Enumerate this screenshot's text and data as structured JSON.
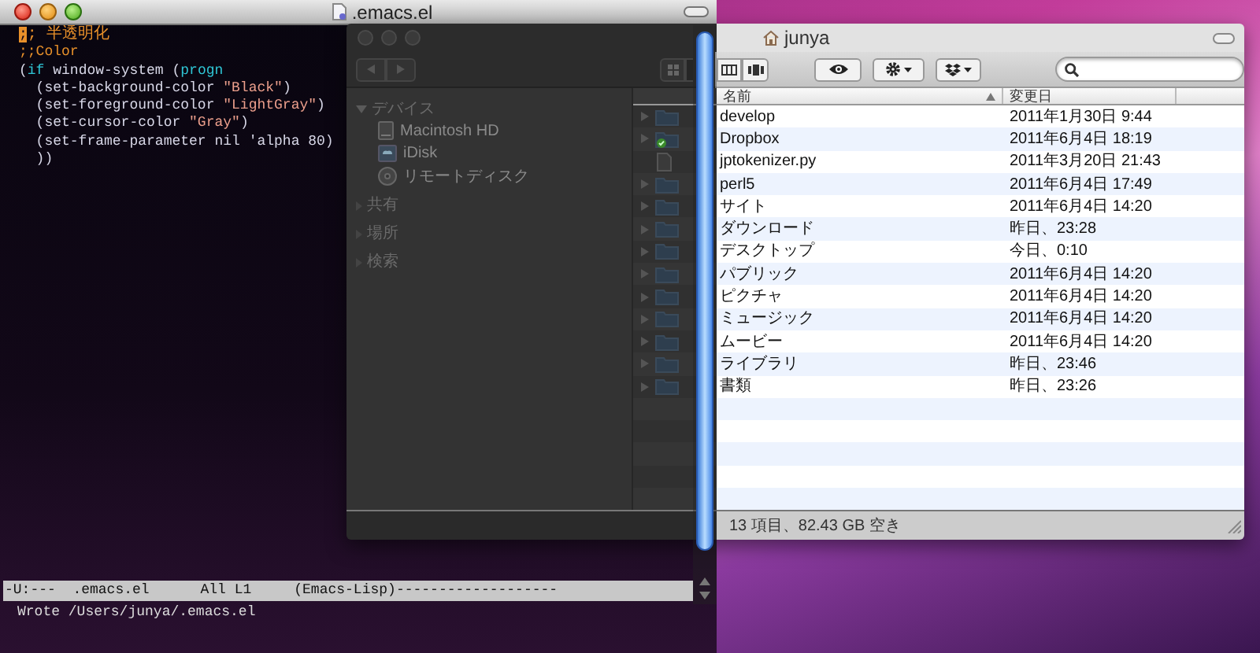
{
  "emacs": {
    "title": ".emacs.el",
    "lines": [
      [
        {
          "kind": "cursor",
          "text": ";"
        },
        {
          "kind": "comment",
          "text": "; 半透明化"
        }
      ],
      [
        {
          "kind": "comment",
          "text": ";;Color"
        }
      ],
      [
        {
          "kind": "text",
          "text": "("
        },
        {
          "kind": "keyword",
          "text": "if"
        },
        {
          "kind": "text",
          "text": " window-system ("
        },
        {
          "kind": "keyword",
          "text": "progn"
        }
      ],
      [
        {
          "kind": "text",
          "text": "  (set-background-color "
        },
        {
          "kind": "string",
          "text": "\"Black\""
        },
        {
          "kind": "text",
          "text": ")"
        }
      ],
      [
        {
          "kind": "text",
          "text": "  (set-foreground-color "
        },
        {
          "kind": "string",
          "text": "\"LightGray\""
        },
        {
          "kind": "text",
          "text": ")"
        }
      ],
      [
        {
          "kind": "text",
          "text": "  (set-cursor-color "
        },
        {
          "kind": "string",
          "text": "\"Gray\""
        },
        {
          "kind": "text",
          "text": ")"
        }
      ],
      [
        {
          "kind": "text",
          "text": "  (set-frame-parameter nil 'alpha 80)"
        }
      ],
      [
        {
          "kind": "text",
          "text": "  ))"
        }
      ]
    ],
    "mode_line": "-U:---  .emacs.el      All L1     (Emacs-Lisp)-------------------",
    "echo": "Wrote /Users/junya/.emacs.el"
  },
  "finder": {
    "title": "junya",
    "sidebar": [
      {
        "label": "デバイス",
        "expanded": true,
        "items": [
          {
            "kind": "drive",
            "label": "Macintosh HD"
          },
          {
            "kind": "idisk",
            "label": "iDisk"
          },
          {
            "kind": "disc",
            "label": "リモートディスク"
          }
        ]
      },
      {
        "label": "共有",
        "expanded": false
      },
      {
        "label": "場所",
        "expanded": false
      },
      {
        "label": "検索",
        "expanded": false
      }
    ],
    "columns": [
      {
        "label": "名前",
        "sorted": true
      },
      {
        "label": "変更日",
        "sorted": false
      }
    ],
    "rows": [
      {
        "kind": "folder",
        "synced": false,
        "name": "develop",
        "modified": "2011年1月30日 9:44"
      },
      {
        "kind": "folder",
        "synced": true,
        "name": "Dropbox",
        "modified": "2011年6月4日 18:19"
      },
      {
        "kind": "file",
        "synced": false,
        "name": "jptokenizer.py",
        "modified": "2011年3月20日 21:43"
      },
      {
        "kind": "folder",
        "synced": false,
        "name": "perl5",
        "modified": "2011年6月4日 17:49"
      },
      {
        "kind": "folder",
        "synced": false,
        "name": "サイト",
        "modified": "2011年6月4日 14:20"
      },
      {
        "kind": "folder",
        "synced": false,
        "name": "ダウンロード",
        "modified": "昨日、23:28"
      },
      {
        "kind": "folder",
        "synced": false,
        "name": "デスクトップ",
        "modified": "今日、0:10"
      },
      {
        "kind": "folder",
        "synced": false,
        "name": "パブリック",
        "modified": "2011年6月4日 14:20"
      },
      {
        "kind": "folder",
        "synced": false,
        "name": "ピクチャ",
        "modified": "2011年6月4日 14:20"
      },
      {
        "kind": "folder",
        "synced": false,
        "name": "ミュージック",
        "modified": "2011年6月4日 14:20"
      },
      {
        "kind": "folder",
        "synced": false,
        "name": "ムービー",
        "modified": "2011年6月4日 14:20"
      },
      {
        "kind": "folder",
        "synced": false,
        "name": "ライブラリ",
        "modified": "昨日、23:46"
      },
      {
        "kind": "folder",
        "synced": false,
        "name": "書類",
        "modified": "昨日、23:26"
      }
    ],
    "status": "13 項目、82.43 GB 空き"
  }
}
